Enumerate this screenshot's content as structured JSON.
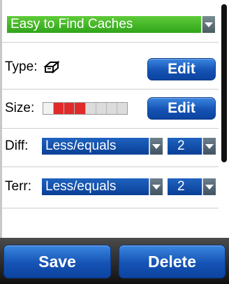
{
  "filter_name": "Easy to Find Caches",
  "type": {
    "label": "Type:",
    "icon": "cache-type-icon",
    "edit_label": "Edit"
  },
  "size": {
    "label": "Size:",
    "filled_cells": 3,
    "total_cells": 8,
    "edit_label": "Edit"
  },
  "difficulty": {
    "label": "Diff:",
    "operator": "Less/equals",
    "value": "2"
  },
  "terrain": {
    "label": "Terr:",
    "operator": "Less/equals",
    "value": "2"
  },
  "footer": {
    "save_label": "Save",
    "delete_label": "Delete"
  },
  "colors": {
    "accent_green": "#2fa41a",
    "accent_blue": "#1553b4",
    "size_on": "#e02a2a"
  }
}
